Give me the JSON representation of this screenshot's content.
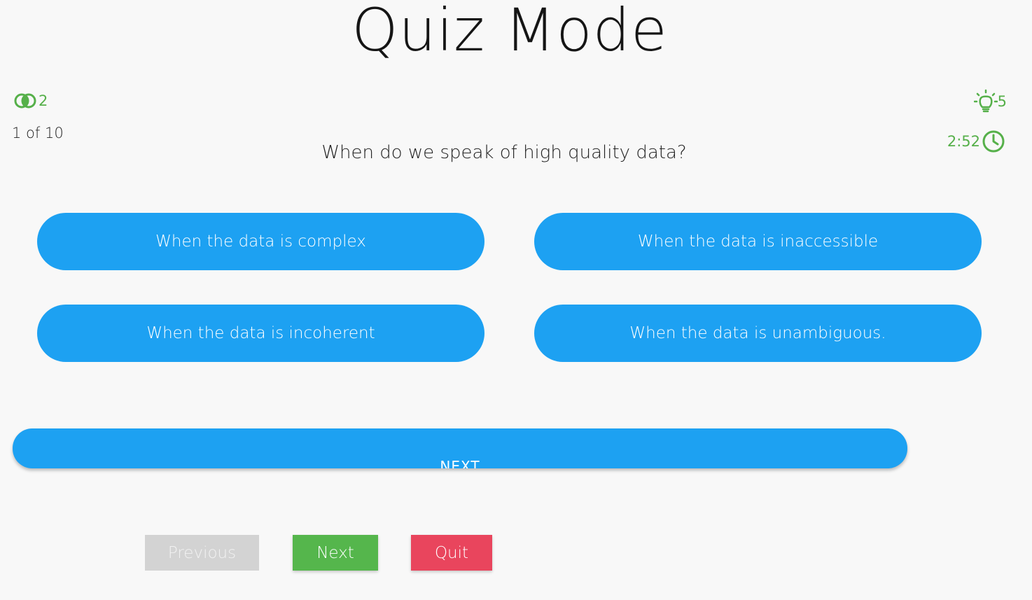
{
  "title": "Quiz Mode",
  "stats": {
    "fifty_fifty_count": "2",
    "fifty_fifty_icon": "fifty-fifty-icon",
    "hints_count": "5",
    "hints_icon": "lightbulb-icon",
    "timer": "2:52",
    "timer_icon": "clock-icon",
    "progress": "1 of 10",
    "accent_color": "#56b04a"
  },
  "question": "When do we speak of high quality data?",
  "options": [
    {
      "label": "When the data is complex"
    },
    {
      "label": "When the data is inaccessible"
    },
    {
      "label": "When the data is incoherent"
    },
    {
      "label": "When the data is unambiguous."
    }
  ],
  "option_color": "#1da1f2",
  "next_bar_label": "NEXT",
  "buttons": {
    "previous": "Previous",
    "next": "Next",
    "quit": "Quit",
    "previous_color": "#d3d3d3",
    "next_color": "#55b64c",
    "quit_color": "#e9455d"
  }
}
